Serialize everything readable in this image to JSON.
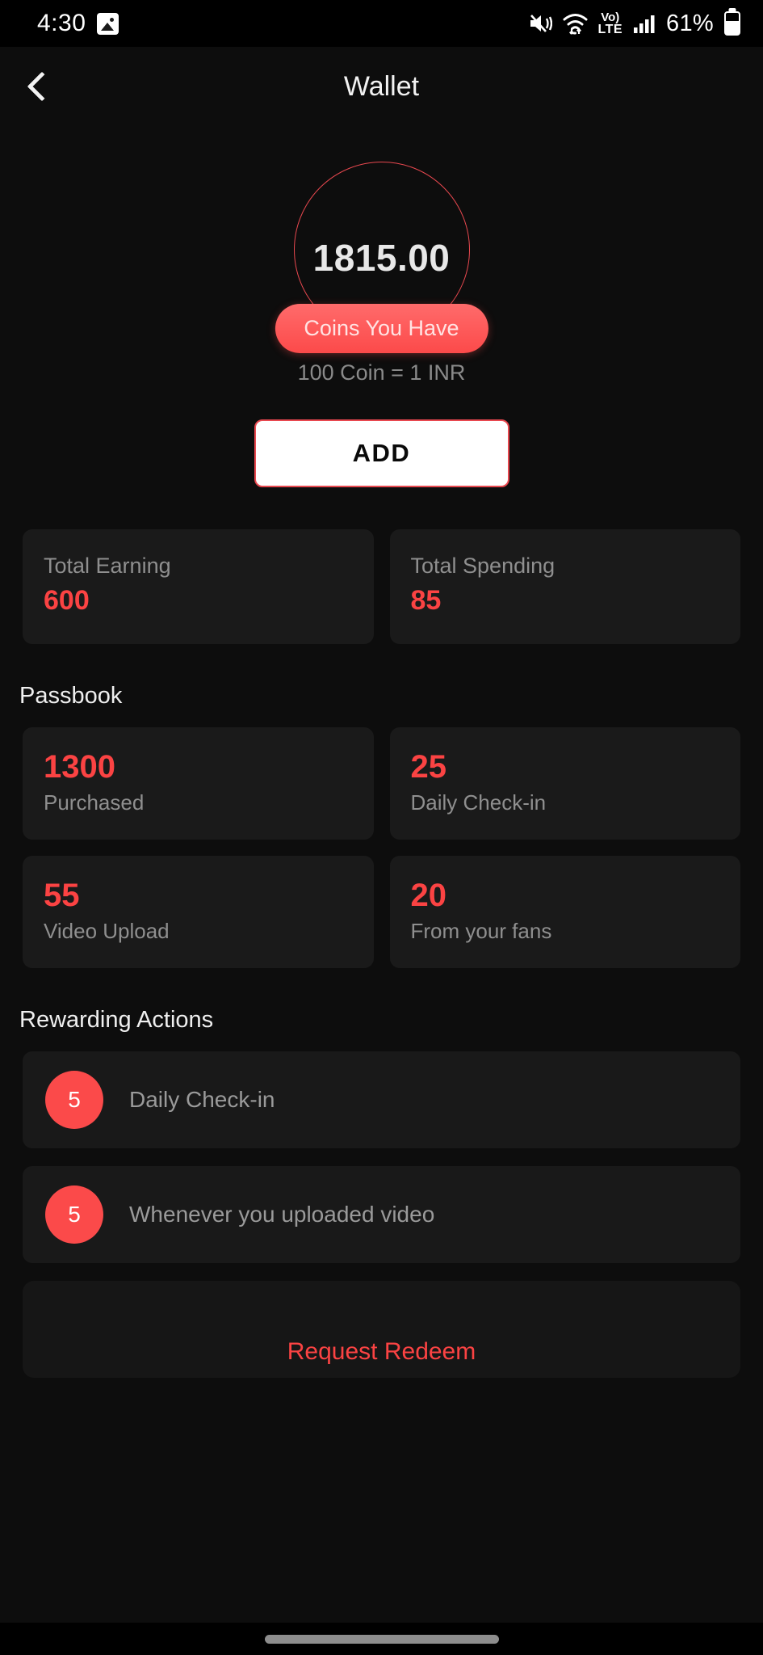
{
  "status_bar": {
    "time": "4:30",
    "battery_percent": "61%",
    "icons": [
      "image-icon",
      "mute-vibrate-icon",
      "wifi-icon",
      "volte-icon",
      "signal-icon",
      "battery-icon"
    ],
    "volte_top": "Vo)",
    "volte_bottom": "LTE"
  },
  "app_bar": {
    "title": "Wallet",
    "back_icon": "chevron-left-icon"
  },
  "balance": {
    "amount": "1815.00",
    "pill_label": "Coins You Have",
    "rate_text": "100 Coin = 1 INR",
    "add_label": "ADD",
    "circle_color": "#e8484f",
    "pill_color": "#fc4a4a"
  },
  "totals": [
    {
      "label": "Total Earning",
      "value": "600"
    },
    {
      "label": "Total Spending",
      "value": "85"
    }
  ],
  "passbook": {
    "title": "Passbook",
    "items": [
      {
        "value": "1300",
        "label": "Purchased"
      },
      {
        "value": "25",
        "label": "Daily Check-in"
      },
      {
        "value": "55",
        "label": "Video Upload"
      },
      {
        "value": "20",
        "label": "From your fans"
      }
    ]
  },
  "rewarding_actions": {
    "title": "Rewarding Actions",
    "items": [
      {
        "coins": "5",
        "label": "Daily Check-in"
      },
      {
        "coins": "5",
        "label": "Whenever you uploaded video"
      }
    ]
  },
  "redeem": {
    "label": "Request Redeem"
  },
  "theme": {
    "background": "#0d0d0d",
    "card": "#1a1a1a",
    "accent": "#fb4343",
    "muted_text": "#8f8f8f"
  }
}
